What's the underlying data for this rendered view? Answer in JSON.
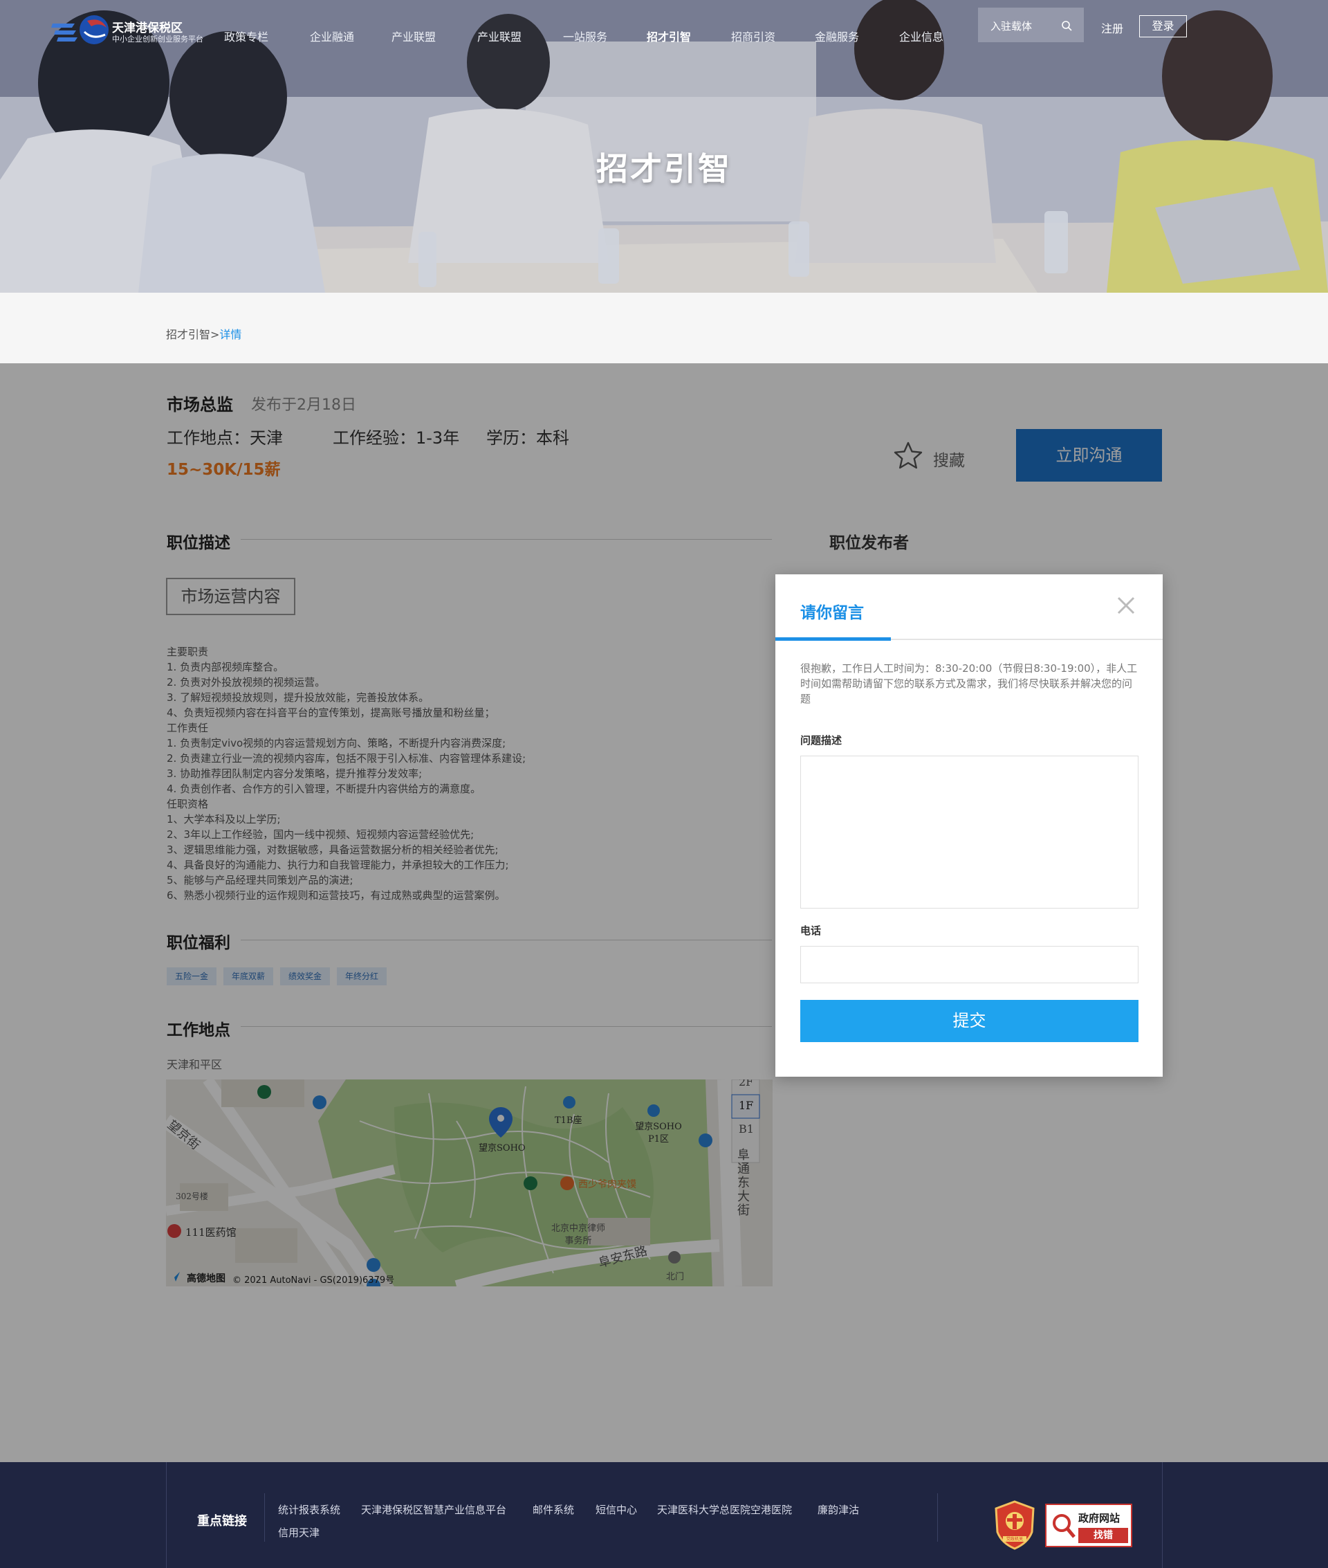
{
  "header": {
    "logo_title": "天津港保税区",
    "logo_subtitle": "中小企业创新创业服务平台",
    "nav": [
      "政策专栏",
      "企业融通",
      "产业联盟",
      "产业联盟",
      "一站服务",
      "招才引智",
      "招商引资",
      "金融服务",
      "企业信息"
    ],
    "active_nav": "招才引智",
    "search_label": "入驻载体",
    "register_label": "注册",
    "login_label": "登录"
  },
  "hero": {
    "title": "招才引智"
  },
  "breadcrumb": {
    "parent": "招才引智",
    "separator": ">",
    "current": "详情"
  },
  "job": {
    "title": "市场总监",
    "published": "发布于2月18日",
    "location": "工作地点：天津",
    "experience": "工作经验：1-3年",
    "education": "学历：本科",
    "salary": "15~30K/15薪",
    "favorite_label": "搜藏",
    "chat_label": "立即沟通"
  },
  "sections": {
    "description_title": "职位描述",
    "publisher_title": "职位发布者",
    "benefits_title": "职位福利",
    "location_title": "工作地点"
  },
  "description": {
    "tag": "市场运营内容",
    "lines": [
      "主要职责",
      "1. 负责内部视频库整合。",
      "2. 负责对外投放视频的视频运营。",
      "3. 了解短视频投放规则，提升投放效能，完善投放体系。",
      "4、负责短视频内容在抖音平台的宣传策划，提高账号播放量和粉丝量；",
      "工作责任",
      "1. 负责制定vivo视频的内容运营规划方向、策略，不断提升内容消费深度;",
      "2. 负责建立行业一流的视频内容库，包括不限于引入标准、内容管理体系建设;",
      "3. 协助推荐团队制定内容分发策略，提升推荐分发效率;",
      "4. 负责创作者、合作方的引入管理，不断提升内容供给方的满意度。",
      "任职资格",
      "1、大学本科及以上学历;",
      "2、3年以上工作经验，国内一线中视频、短视频内容运营经验优先;",
      "3、逻辑思维能力强，对数据敏感，具备运营数据分析的相关经验者优先;",
      "4、具备良好的沟通能力、执行力和自我管理能力，并承担较大的工作压力;",
      "5、能够与产品经理共同策划产品的演进;",
      "6、熟悉小视频行业的运作规则和运营技巧，有过成熟或典型的运营案例。"
    ]
  },
  "benefits": [
    "五险一金",
    "年底双薪",
    "绩效奖金",
    "年终分红"
  ],
  "location": {
    "address": "天津和平区",
    "map_labels": {
      "street1": "望京街",
      "poi1": "望京SOHO",
      "poi2": "T1B座",
      "poi3": "望京SOHO P1区",
      "poi4": "西少爷肉夹馍",
      "poi5": "北京中京律师事务所",
      "poi6": "111医药馆",
      "poi7": "302号楼",
      "street2": "阜安东路",
      "street3": "阜通东大街",
      "gate": "北门",
      "floors": [
        "2F",
        "1F",
        "B1"
      ],
      "brand": "高德地图",
      "copyright": "© 2021 AutoNavi - GS(2019)6379号"
    }
  },
  "modal": {
    "title": "请你留言",
    "notice": "很抱歉，工作日人工时间为：8:30-20:00（节假日8:30-19:00），非人工时间如需帮助请留下您的联系方式及需求，我们将尽快联系并解决您的问题",
    "question_label": "问题描述",
    "phone_label": "电话",
    "submit_label": "提交"
  },
  "footer": {
    "key_links_label": "重点链接",
    "links": [
      "统计报表系统",
      "天津港保税区智慧产业信息平台",
      "邮件系统",
      "短信中心",
      "天津医科大学总医院空港医院",
      "廉韵津沽",
      "信用天津"
    ],
    "badge_gov_line1": "政府网站",
    "badge_gov_line2": "找错",
    "badge_party": "党政机关"
  },
  "colors": {
    "accent_blue": "#1e73c9",
    "link_blue": "#1a8fe6",
    "salary_orange": "#ef7b22",
    "submit_blue": "#1fa3ee",
    "footer_bg": "#1f2541"
  }
}
